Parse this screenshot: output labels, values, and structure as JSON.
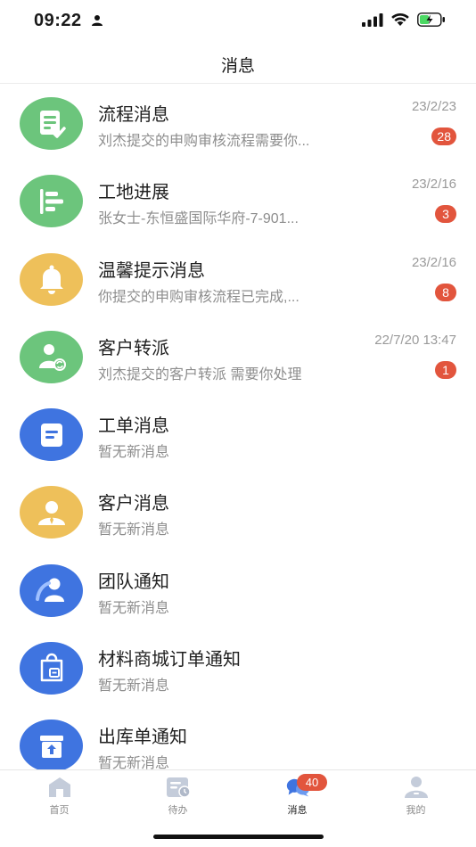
{
  "status_bar": {
    "time": "09:22"
  },
  "header": {
    "title": "消息"
  },
  "messages": [
    {
      "title": "流程消息",
      "subtitle": "刘杰提交的申购审核流程需要你...",
      "time": "23/2/23",
      "badge": "28",
      "icon": "document-check-icon",
      "color": "#6cc57c"
    },
    {
      "title": "工地进展",
      "subtitle": "张女士-东恒盛国际华府-7-901...",
      "time": "23/2/16",
      "badge": "3",
      "icon": "progress-bars-icon",
      "color": "#6cc57c"
    },
    {
      "title": "温馨提示消息",
      "subtitle": "你提交的申购审核流程已完成,...",
      "time": "23/2/16",
      "badge": "8",
      "icon": "bell-icon",
      "color": "#eec05a"
    },
    {
      "title": "客户转派",
      "subtitle": "刘杰提交的客户转派 需要你处理",
      "time": "22/7/20 13:47",
      "badge": "1",
      "icon": "user-transfer-icon",
      "color": "#6cc57c"
    },
    {
      "title": "工单消息",
      "subtitle": "暂无新消息",
      "time": "",
      "badge": "",
      "icon": "work-order-icon",
      "color": "#3f74e0"
    },
    {
      "title": "客户消息",
      "subtitle": "暂无新消息",
      "time": "",
      "badge": "",
      "icon": "customer-icon",
      "color": "#eec05a"
    },
    {
      "title": "团队通知",
      "subtitle": "暂无新消息",
      "time": "",
      "badge": "",
      "icon": "team-icon",
      "color": "#3f74e0"
    },
    {
      "title": "材料商城订单通知",
      "subtitle": "暂无新消息",
      "time": "",
      "badge": "",
      "icon": "shopping-bag-icon",
      "color": "#3f74e0"
    },
    {
      "title": "出库单通知",
      "subtitle": "暂无新消息",
      "time": "",
      "badge": "",
      "icon": "outbound-box-icon",
      "color": "#3f74e0"
    }
  ],
  "tabs": [
    {
      "label": "首页",
      "icon": "home-icon",
      "active": false
    },
    {
      "label": "待办",
      "icon": "todo-icon",
      "active": false
    },
    {
      "label": "消息",
      "icon": "chat-icon",
      "active": true,
      "badge": "40"
    },
    {
      "label": "我的",
      "icon": "profile-icon",
      "active": false
    }
  ]
}
